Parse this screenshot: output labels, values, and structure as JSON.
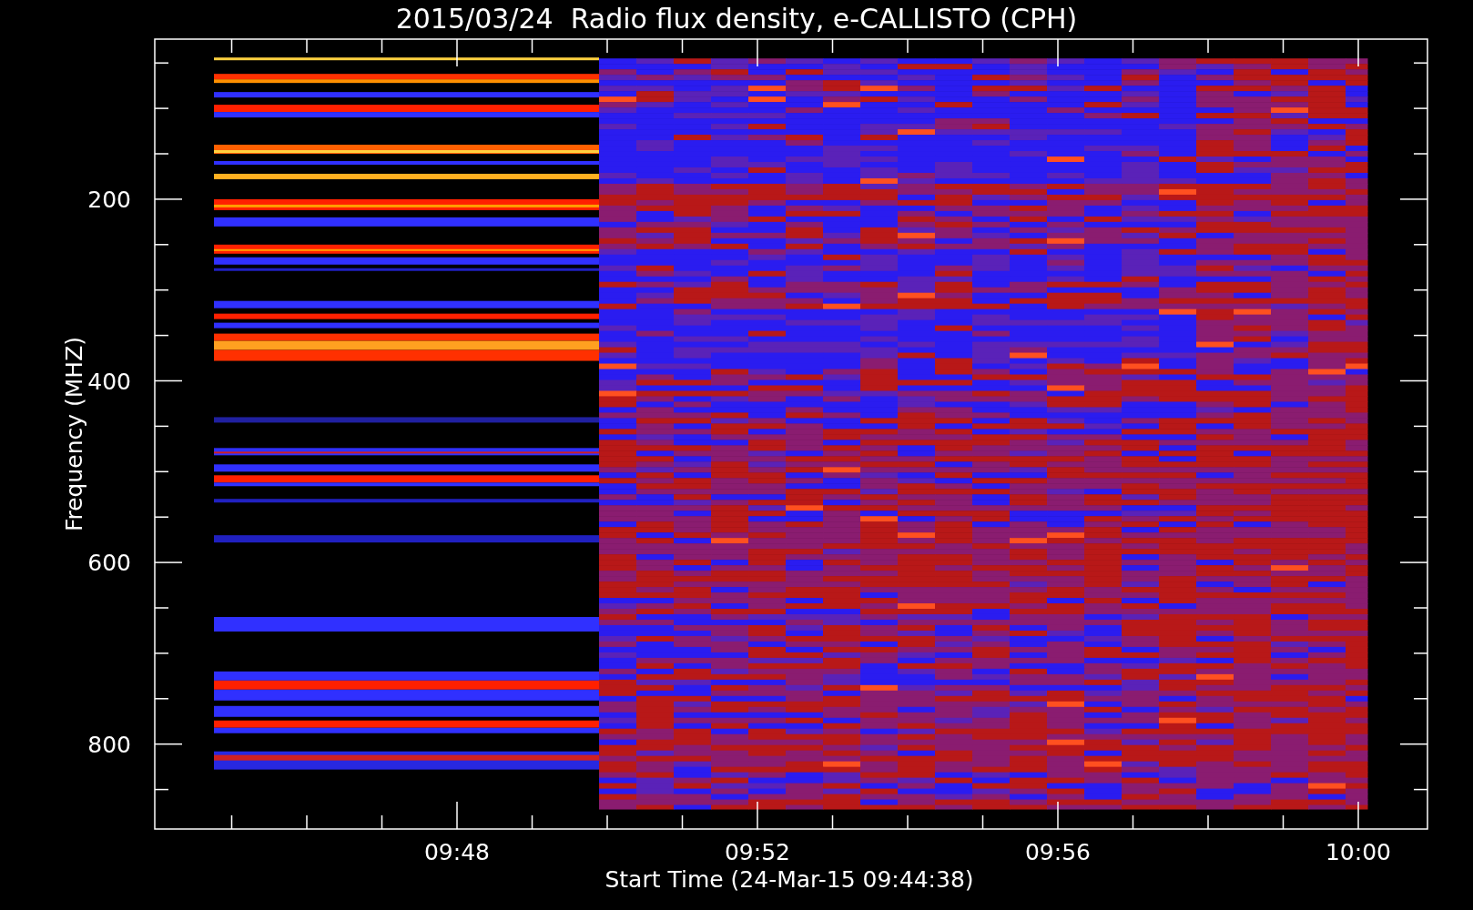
{
  "plot": {
    "title": "2015/03/24  Radio flux density, e-CALLISTO (CPH)",
    "ylabel": "Frequency (MHZ)",
    "xlabel": "Start Time (24-Mar-15 09:44:38)",
    "yticks": [
      "200",
      "400",
      "600",
      "800"
    ],
    "xticks": [
      "09:48",
      "09:52",
      "09:56",
      "10:00"
    ]
  }
}
